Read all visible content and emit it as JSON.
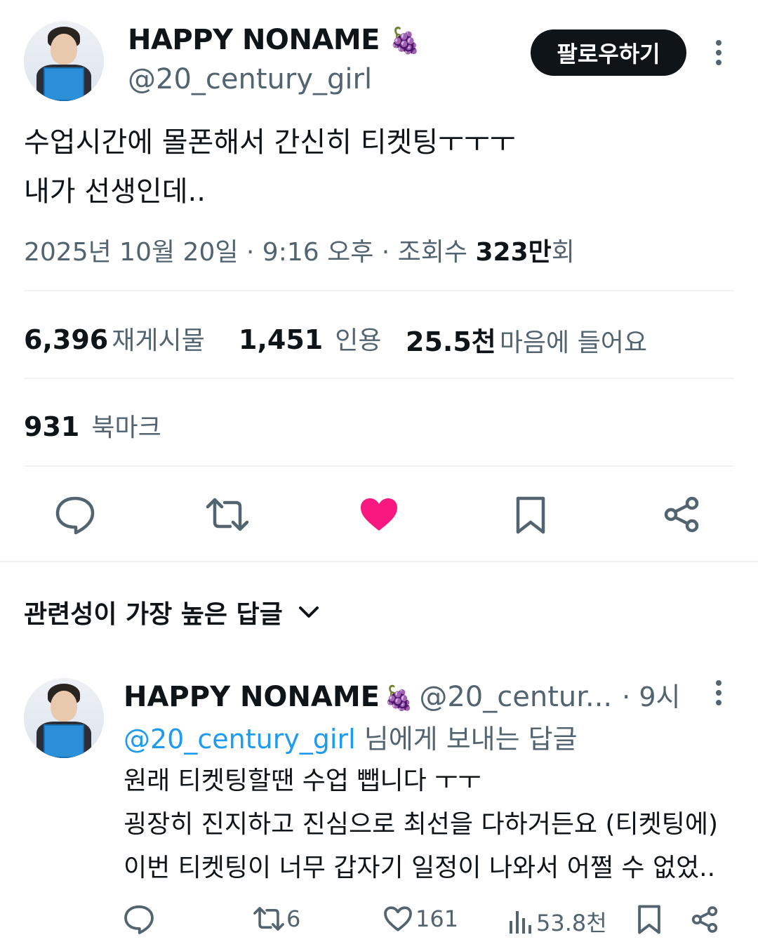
{
  "tweet": {
    "author_name": "HAPPY NONAME",
    "author_emoji": "🍇",
    "author_handle": "@20_century_girl",
    "follow_label": "팔로우하기",
    "text_line1": "수업시간에 몰폰해서 간신히 티켓팅ㅜㅜㅜ",
    "text_line2": "내가 선생인데..",
    "date_time": "2025년 10월 20일 · 9:16 오후 · 조회수 ",
    "views_value": "323만",
    "views_suffix": "회",
    "stats": {
      "reposts_count": "6,396",
      "reposts_label": "재게시물",
      "quotes_count": "1,451",
      "quotes_label": "인용",
      "likes_count": "25.5천",
      "likes_label": "마음에 들어요",
      "bookmarks_count": "931",
      "bookmarks_label": "북마크"
    },
    "like_color": "#f91880"
  },
  "replies_section": {
    "title": "관련성이 가장 높은 답글"
  },
  "reply": {
    "author_name": "HAPPY NONAME",
    "author_emoji": "🍇",
    "author_handle": "@20_centur...",
    "time": "· 9시",
    "reply_to_link": "@20_century_girl",
    "reply_to_suffix": " 님에게 보내는 답글",
    "line1": "원래 티켓팅할땐 수업 뺍니다 ㅜㅜ",
    "line2": "굉장히 진지하고 진심으로 최선을 다하거든요 (티켓팅에)",
    "line3": "이번 티켓팅이 너무 갑자기 일정이 나와서 어쩔 수 없었..",
    "retweets": "6",
    "likes": "161",
    "views": "53.8천"
  },
  "icons": {
    "reply": "reply-bubble-icon",
    "retweet": "retweet-icon",
    "like": "heart-icon",
    "bookmark": "bookmark-icon",
    "share": "share-icon",
    "more": "more-vertical-icon",
    "views": "analytics-icon",
    "chevron": "chevron-down-icon"
  }
}
